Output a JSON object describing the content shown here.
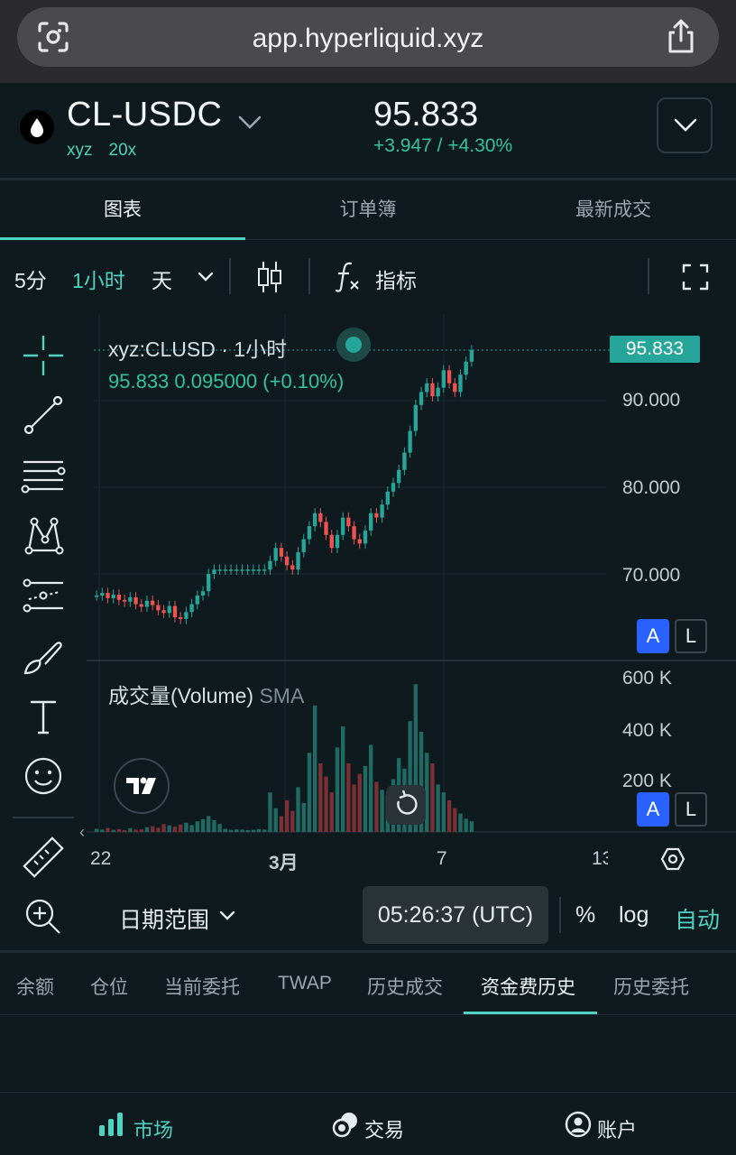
{
  "browser": {
    "url": "app.hyperliquid.xyz"
  },
  "header": {
    "pair": "CL-USDC",
    "dex": "xyz",
    "leverage": "20x",
    "price": "95.833",
    "change": "+3.947 / +4.30%"
  },
  "tabs": [
    {
      "label": "图表"
    },
    {
      "label": "订单簿"
    },
    {
      "label": "最新成交"
    }
  ],
  "toolbar": {
    "interval_5m": "5分",
    "interval_1h": "1小时",
    "interval_day": "天",
    "indicators": "指标"
  },
  "chart": {
    "title": "xyz:CLUSD · 1小时",
    "ohlc": "95.833  0.095000 (+0.10%)",
    "last_price_label": "95.833",
    "y_labels": [
      "90.000",
      "80.000",
      "70.000"
    ],
    "volume_title": "成交量(Volume)",
    "volume_sma": "SMA",
    "volume_y_labels": [
      "600 K",
      "400 K",
      "200 K"
    ],
    "x_labels": [
      "22",
      "3月",
      "7",
      "13"
    ],
    "auto_btn": "A",
    "log_btn": "L",
    "colors": {
      "up": "#26a69a",
      "down": "#ef5350",
      "accent": "#50d2c2"
    }
  },
  "chart_data": {
    "type": "line",
    "title": "xyz:CLUSD · 1小时",
    "xlabel": "",
    "ylabel": "",
    "x_ticks": [
      "22",
      "3月",
      "7",
      "13"
    ],
    "y_ticks": [
      70,
      80,
      90
    ],
    "ylim": [
      60,
      100
    ],
    "series": [
      {
        "values": [
          67.5,
          67.8,
          67.2,
          67.6,
          67.0,
          66.8,
          67.3,
          66.5,
          66.2,
          66.9,
          66.4,
          65.8,
          65.5,
          66.3,
          65.0,
          64.8,
          65.6,
          66.5,
          67.5,
          68.0,
          70.0,
          70.5,
          70.5,
          70.5,
          70.5,
          70.5,
          70.5,
          70.5,
          70.5,
          70.5,
          70.5,
          71.5,
          73.0,
          72.0,
          71.0,
          70.5,
          72.5,
          74.0,
          75.5,
          77.0,
          76.0,
          74.5,
          73.0,
          74.5,
          76.5,
          75.5,
          74.0,
          73.5,
          75.0,
          77.0,
          76.5,
          78.0,
          79.5,
          80.5,
          82.0,
          84.0,
          86.5,
          89.5,
          91.0,
          92.0,
          90.5,
          91.5,
          93.5,
          92.0,
          91.0,
          93.0,
          94.5,
          95.833
        ]
      }
    ],
    "volume_ylim": [
      0,
      650000
    ],
    "volume": [
      12000,
      9000,
      15000,
      8000,
      11000,
      7000,
      14000,
      9000,
      10000,
      18000,
      22000,
      16000,
      30000,
      25000,
      20000,
      28000,
      35000,
      26000,
      40000,
      48000,
      60000,
      45000,
      30000,
      12000,
      8000,
      10000,
      9000,
      7000,
      8000,
      11000,
      9000,
      150000,
      90000,
      60000,
      120000,
      80000,
      170000,
      110000,
      300000,
      480000,
      260000,
      210000,
      150000,
      320000,
      400000,
      260000,
      180000,
      220000,
      250000,
      330000,
      190000,
      160000,
      140000,
      200000,
      280000,
      240000,
      420000,
      560000,
      380000,
      300000,
      260000,
      180000,
      150000,
      120000,
      90000,
      70000,
      50000,
      40000
    ]
  },
  "chart_footer": {
    "date_range": "日期范围",
    "time": "05:26:37 (UTC)",
    "percent": "%",
    "log": "log",
    "auto": "自动"
  },
  "account_tabs": [
    {
      "label": "余额"
    },
    {
      "label": "仓位"
    },
    {
      "label": "当前委托"
    },
    {
      "label": "TWAP"
    },
    {
      "label": "历史成交"
    },
    {
      "label": "资金费历史"
    },
    {
      "label": "历史委托"
    }
  ],
  "bottom_nav": [
    {
      "label": "市场"
    },
    {
      "label": "交易"
    },
    {
      "label": "账户"
    }
  ]
}
